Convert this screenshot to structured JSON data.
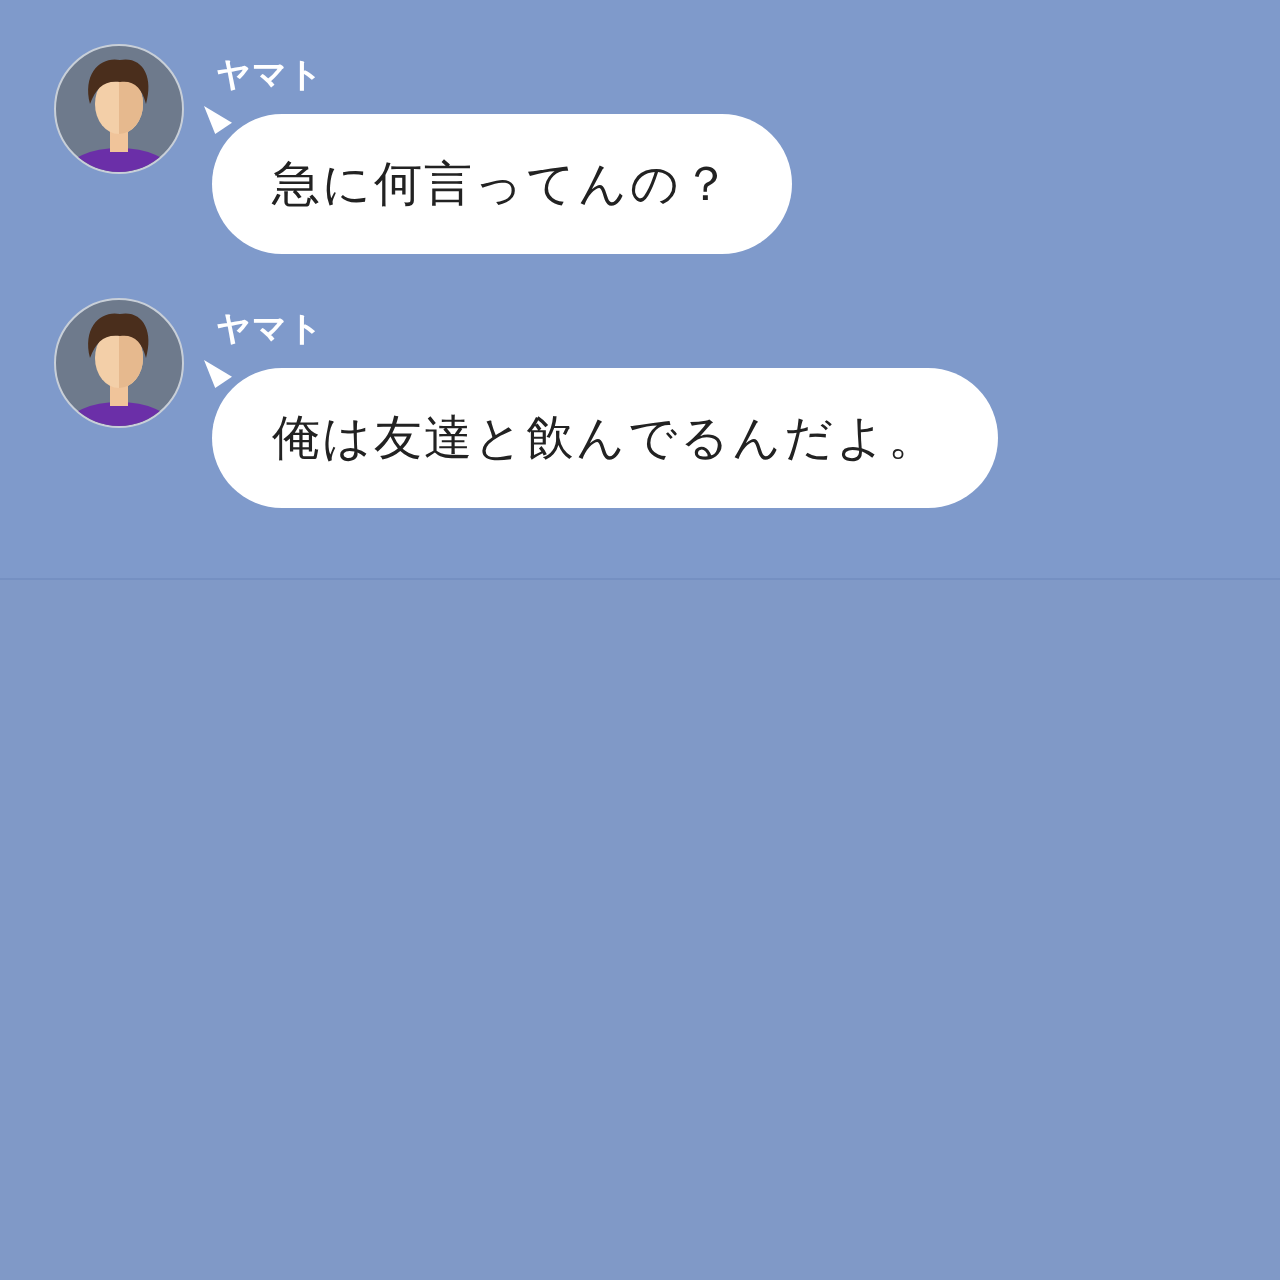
{
  "messages": [
    {
      "sender": "ヤマト",
      "text": "急に何言ってんの？"
    },
    {
      "sender": "ヤマト",
      "text": "俺は友達と飲んでるんだよ。"
    }
  ]
}
